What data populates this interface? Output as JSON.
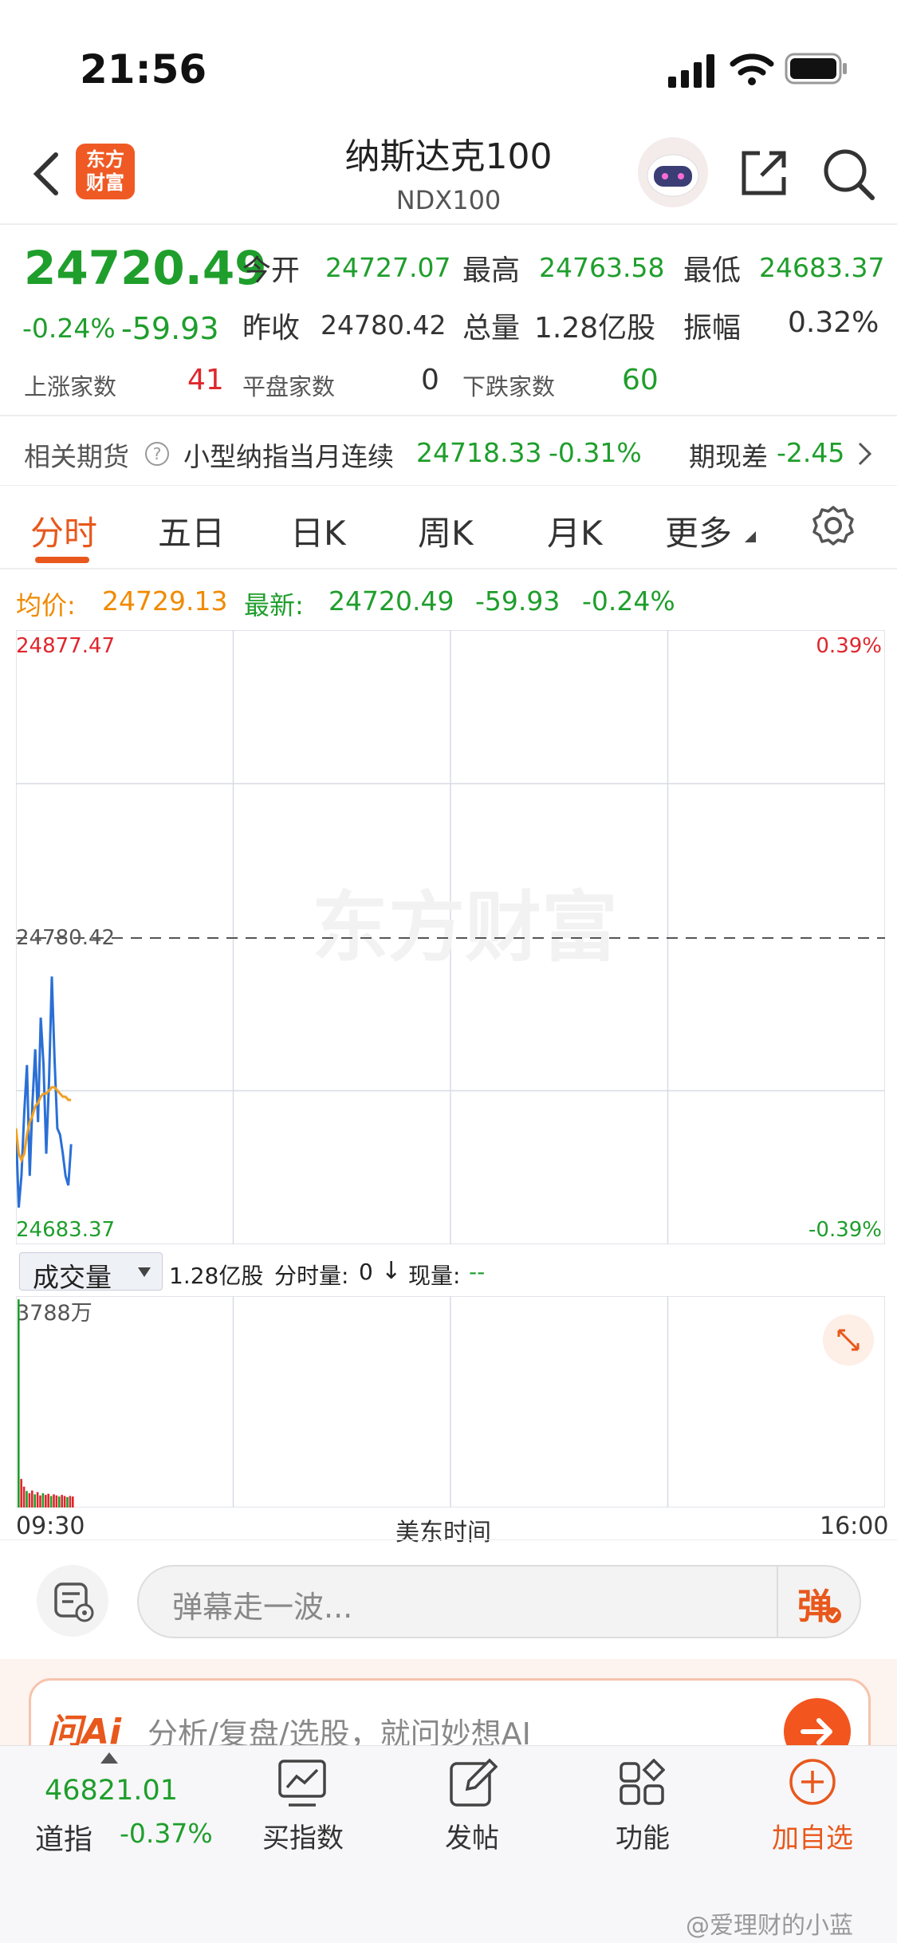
{
  "status_bar": {
    "time": "21:56"
  },
  "header": {
    "logo_line1": "东方",
    "logo_line2": "财富",
    "title": "纳斯达克100",
    "subtitle": "NDX100"
  },
  "quote": {
    "price": "24720.49",
    "change_pct": "-0.24%",
    "change": "-59.93",
    "open_label": "今开",
    "open": "24727.07",
    "high_label": "最高",
    "high": "24763.58",
    "low_label": "最低",
    "low": "24683.37",
    "prev_close_label": "昨收",
    "prev_close": "24780.42",
    "volume_label": "总量",
    "volume": "1.28亿股",
    "amplitude_label": "振幅",
    "amplitude": "0.32%",
    "up_label": "上涨家数",
    "up_count": "41",
    "flat_label": "平盘家数",
    "flat_count": "0",
    "down_label": "下跌家数",
    "down_count": "60"
  },
  "futures": {
    "label": "相关期货",
    "name": "小型纳指当月连续",
    "price": "24718.33",
    "pct": "-0.31%",
    "basis_label": "期现差",
    "basis": "-2.45"
  },
  "tabs": [
    {
      "label": "分时"
    },
    {
      "label": "五日"
    },
    {
      "label": "日K"
    },
    {
      "label": "周K"
    },
    {
      "label": "月K"
    },
    {
      "label": "更多"
    }
  ],
  "summary": {
    "avg_label": "均价:",
    "avg": "24729.13",
    "latest_label": "最新:",
    "latest": "24720.49",
    "change": "-59.93",
    "pct": "-0.24%"
  },
  "chart_labels": {
    "y_max": "24877.47",
    "y_mid": "24780.42",
    "y_min": "24683.37",
    "pct_max": "0.39%",
    "pct_min": "-0.39%",
    "watermark": "东方财富"
  },
  "volume_bar": {
    "select": "成交量",
    "total": "1.28亿股",
    "tick_label": "分时量:",
    "tick_val": "0",
    "now_label": "现量:",
    "now_val": "--",
    "max_label": "3788万",
    "x_start": "09:30",
    "x_mid": "美东时间",
    "x_end": "16:00"
  },
  "danmu": {
    "placeholder": "弹幕走一波...",
    "button": "弹"
  },
  "ai_bar": {
    "brand": "问Ai",
    "text": "分析/复盘/选股，就问妙想AI"
  },
  "footer": {
    "index_value": "46821.01",
    "index_name": "道指",
    "index_pct": "-0.37%",
    "items": [
      {
        "label": "买指数"
      },
      {
        "label": "发帖"
      },
      {
        "label": "功能"
      },
      {
        "label": "加自选"
      }
    ]
  },
  "watermark_user": "@爱理财的小蓝",
  "chart_data": {
    "type": "line",
    "title": "",
    "xlabel": "美东时间",
    "ylabel": "",
    "ylim": [
      24683.37,
      24877.47
    ],
    "reference_line": 24780.42,
    "x_range": [
      "09:30",
      "16:00"
    ],
    "series": [
      {
        "values": [
          24720,
          24695,
          24705,
          24725,
          24740,
          24705,
          24728,
          24745,
          24722,
          24755,
          24740,
          24712,
          24735,
          24768,
          24742,
          24720,
          24718,
          24712,
          24705,
          24702,
          24715
        ]
      },
      {
        "values": [
          24720,
          24712,
          24710,
          24712,
          24718,
          24722,
          24724,
          24727,
          24728,
          24730,
          24731,
          24731,
          24732,
          24733,
          24733,
          24732,
          24731,
          24730,
          24730,
          24729,
          24729
        ]
      }
    ],
    "volume": {
      "max_label": "3788万",
      "values": [
        3788,
        520,
        380,
        300,
        260,
        310,
        240,
        280,
        220,
        260,
        230,
        250,
        210,
        240,
        220,
        200,
        230,
        210,
        190,
        210,
        200
      ]
    }
  }
}
